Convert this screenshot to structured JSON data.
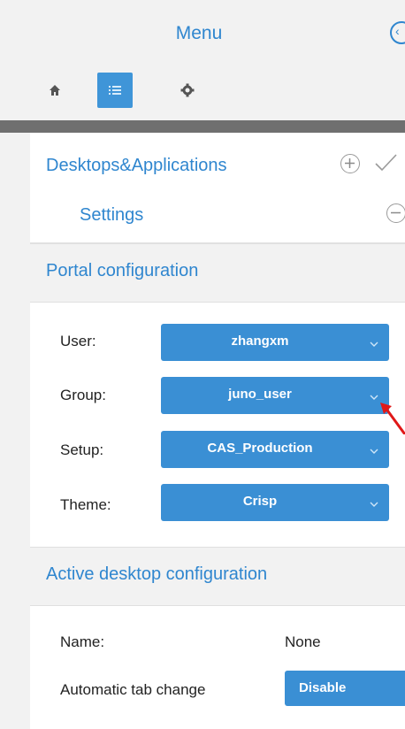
{
  "header": {
    "title": "Menu",
    "toolbar": {
      "home_icon": "home-icon",
      "list_icon": "list-icon",
      "settings_icon": "gear-icon"
    },
    "collapse_icon": "chevron-left-icon"
  },
  "accordion": {
    "desktops_label": "Desktops&Applications",
    "settings_label": "Settings"
  },
  "portal_config": {
    "title": "Portal configuration",
    "fields": [
      {
        "label": "User:",
        "value": "zhangxm"
      },
      {
        "label": "Group:",
        "value": "juno_user"
      },
      {
        "label": "Setup:",
        "value": "CAS_Production"
      },
      {
        "label": "Theme:",
        "value": "Crisp"
      }
    ]
  },
  "active_desktop": {
    "title": "Active desktop configuration",
    "name_label": "Name:",
    "name_value": "None",
    "auto_tab_label": "Automatic tab change",
    "auto_tab_value": "Disable"
  },
  "colors": {
    "accent": "#2f86cf",
    "select_bg": "#3a8fd4",
    "section_bg": "#f2f2f2",
    "arrow": "#e01818"
  }
}
